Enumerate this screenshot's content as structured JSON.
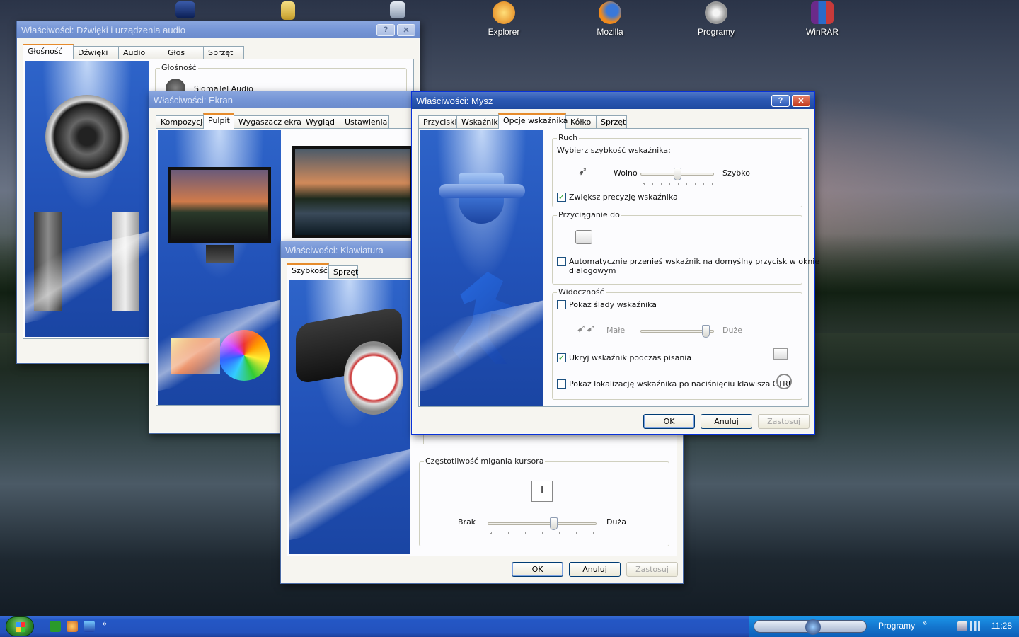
{
  "desktop": {
    "icons": [
      {
        "label": "Explorer"
      },
      {
        "label": "Mozilla"
      },
      {
        "label": "Programy"
      },
      {
        "label": "WinRAR"
      }
    ]
  },
  "windows": {
    "sound": {
      "title": "Właściwości: Dźwięki i urządzenia audio",
      "tabs": [
        "Głośność",
        "Dźwięki",
        "Audio",
        "Głos",
        "Sprzęt"
      ],
      "group_label": "Głośność",
      "device": "SigmaTel Audio"
    },
    "display": {
      "title": "Właściwości: Ekran",
      "tabs": [
        "Kompozycje",
        "Pulpit",
        "Wygaszacz ekranu",
        "Wygląd",
        "Ustawienia"
      ]
    },
    "keyboard": {
      "title": "Właściwości: Klawiatura",
      "tabs": [
        "Szybkość",
        "Sprzęt"
      ],
      "blink_group": "Częstotliwość migania kursora",
      "cursor_glyph": "I",
      "slider_min": "Brak",
      "slider_max": "Duża",
      "blink_rate_fraction": 0.62,
      "buttons": {
        "ok": "OK",
        "cancel": "Anuluj",
        "apply": "Zastosuj"
      }
    },
    "mouse": {
      "title": "Właściwości: Mysz",
      "tabs": [
        "Przyciski",
        "Wskaźniki",
        "Opcje wskaźnika",
        "Kółko",
        "Sprzęt"
      ],
      "motion": {
        "group": "Ruch",
        "prompt": "Wybierz szybkość wskaźnika:",
        "min": "Wolno",
        "max": "Szybko",
        "speed_fraction": 0.5,
        "precision": "Zwiększ precyzję wskaźnika"
      },
      "snap": {
        "group": "Przyciąganie do",
        "option_line1": "Automatycznie przenieś wskaźnik na domyślny przycisk w oknie",
        "option_line2": "dialogowym"
      },
      "visibility": {
        "group": "Widoczność",
        "trails": "Pokaż ślady wskaźnika",
        "trail_min": "Małe",
        "trail_max": "Duże",
        "trail_fraction": 0.95,
        "hide": "Ukryj wskaźnik podczas pisania",
        "ctrl": "Pokaż lokalizację wskaźnika po naciśnięciu klawisza CTRL"
      },
      "buttons": {
        "ok": "OK",
        "cancel": "Anuluj",
        "apply": "Zastosuj"
      }
    }
  },
  "taskbar": {
    "tray_label": "Programy",
    "chevron": "»",
    "clock": "11:28"
  }
}
